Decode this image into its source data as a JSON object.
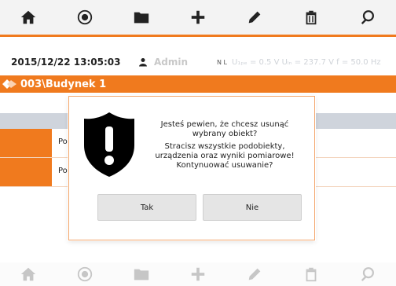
{
  "toolbar_top": {
    "icons": [
      "home-icon",
      "record-icon",
      "folder-icon",
      "plus-icon",
      "pencil-icon",
      "trash-icon",
      "search-icon"
    ]
  },
  "status": {
    "datetime": "2015/12/22 13:05:03",
    "user": "Admin",
    "measurement": "U₁ₚₑ = 0.5 V  Uₗₙ = 237.7 V  f = 50.0 Hz",
    "line_labels": "N L"
  },
  "path": {
    "label": "003\\Budynek 1"
  },
  "rows": [
    {
      "text": "Po"
    },
    {
      "text": "Po"
    }
  ],
  "dialog": {
    "message_line1": "Jesteś pewien, że chcesz usunąć",
    "message_line2": "wybrany obiekt?",
    "message_line3": "Stracisz wszystkie podobiekty,",
    "message_line4": "urządzenia oraz wyniki pomiarowe!",
    "message_line5": "Kontynuować usuwanie?",
    "yes_label": "Tak",
    "no_label": "Nie"
  },
  "colors": {
    "accent": "#f07a1e",
    "header_row": "#cfd4dc"
  }
}
